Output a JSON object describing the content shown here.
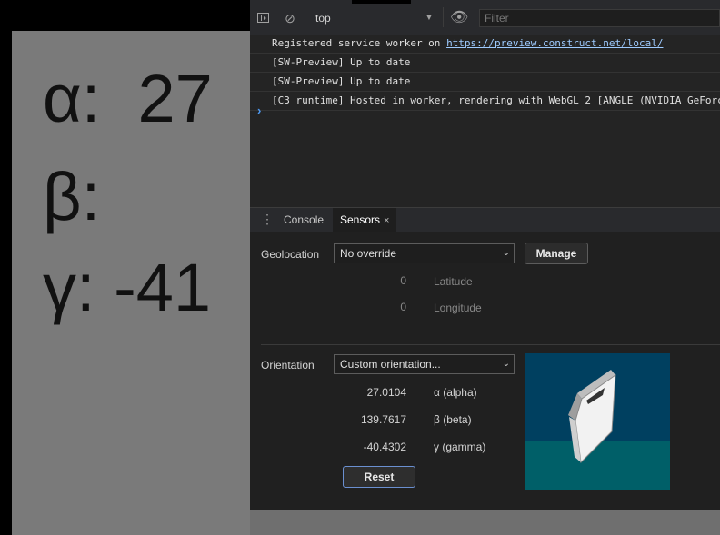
{
  "game": {
    "alpha_line": "α:  27",
    "beta_line": "β:",
    "gamma_line": "γ: -41"
  },
  "toolbar": {
    "context": "top",
    "filter_placeholder": "Filter"
  },
  "console": {
    "lines": [
      {
        "prefix": "Registered service worker on ",
        "link": "https://preview.construct.net/local/"
      },
      {
        "text": "[SW-Preview] Up to date"
      },
      {
        "text": "[SW-Preview] Up to date"
      },
      {
        "text": "[C3 runtime] Hosted in worker, rendering with WebGL 2 [ANGLE (NVIDIA GeForce"
      }
    ],
    "prompt": "›"
  },
  "drawer": {
    "tabs": [
      {
        "label": "Console"
      },
      {
        "label": "Sensors",
        "close": "×"
      }
    ]
  },
  "sensors": {
    "geolocation_label": "Geolocation",
    "geolocation_value": "No override",
    "manage_label": "Manage",
    "latitude_value": "0",
    "latitude_label": "Latitude",
    "longitude_value": "0",
    "longitude_label": "Longitude",
    "orientation_label": "Orientation",
    "orientation_value": "Custom orientation...",
    "alpha_value": "27.0104",
    "alpha_label": "α (alpha)",
    "beta_value": "139.7617",
    "beta_label": "β (beta)",
    "gamma_value": "-40.4302",
    "gamma_label": "γ (gamma)",
    "reset_label": "Reset"
  },
  "colors": {
    "preview_sky": "#004060",
    "preview_floor": "#005f68",
    "accent_link": "#9ecbff"
  }
}
